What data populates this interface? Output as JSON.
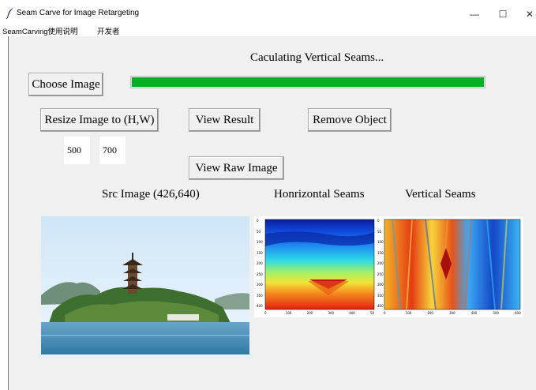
{
  "window": {
    "title": "Seam Carve for Image Retargeting",
    "minimize_glyph": "—",
    "maximize_glyph": "☐",
    "close_glyph": "✕"
  },
  "menu": [
    "SeamCarving使用说明",
    "开发者"
  ],
  "status": "Caculating Vertical Seams...",
  "progress": {
    "value": 1.0,
    "color": "#06b025"
  },
  "buttons": {
    "choose_image": "Choose Image",
    "resize": "Resize Image to (H,W)",
    "view_result": "View Result",
    "remove_object": "Remove Object",
    "view_raw": "View Raw Image"
  },
  "inputs": {
    "height": "500",
    "width": "700"
  },
  "labels": {
    "src": "Src Image (426,640)",
    "horizontal": "Honrizontal Seams",
    "vertical": "Vertical Seams"
  },
  "horizontal_plot": {
    "yticks": [
      "0",
      "50",
      "100",
      "150",
      "200",
      "250",
      "300",
      "350",
      "400"
    ],
    "xticks": [
      "0",
      "100",
      "200",
      "300",
      "400",
      "50"
    ]
  },
  "vertical_plot": {
    "yticks": [
      "0",
      "50",
      "100",
      "150",
      "200",
      "250",
      "300",
      "350",
      "400"
    ],
    "xticks": [
      "0",
      "100",
      "200",
      "300",
      "400",
      "500",
      "600"
    ]
  }
}
